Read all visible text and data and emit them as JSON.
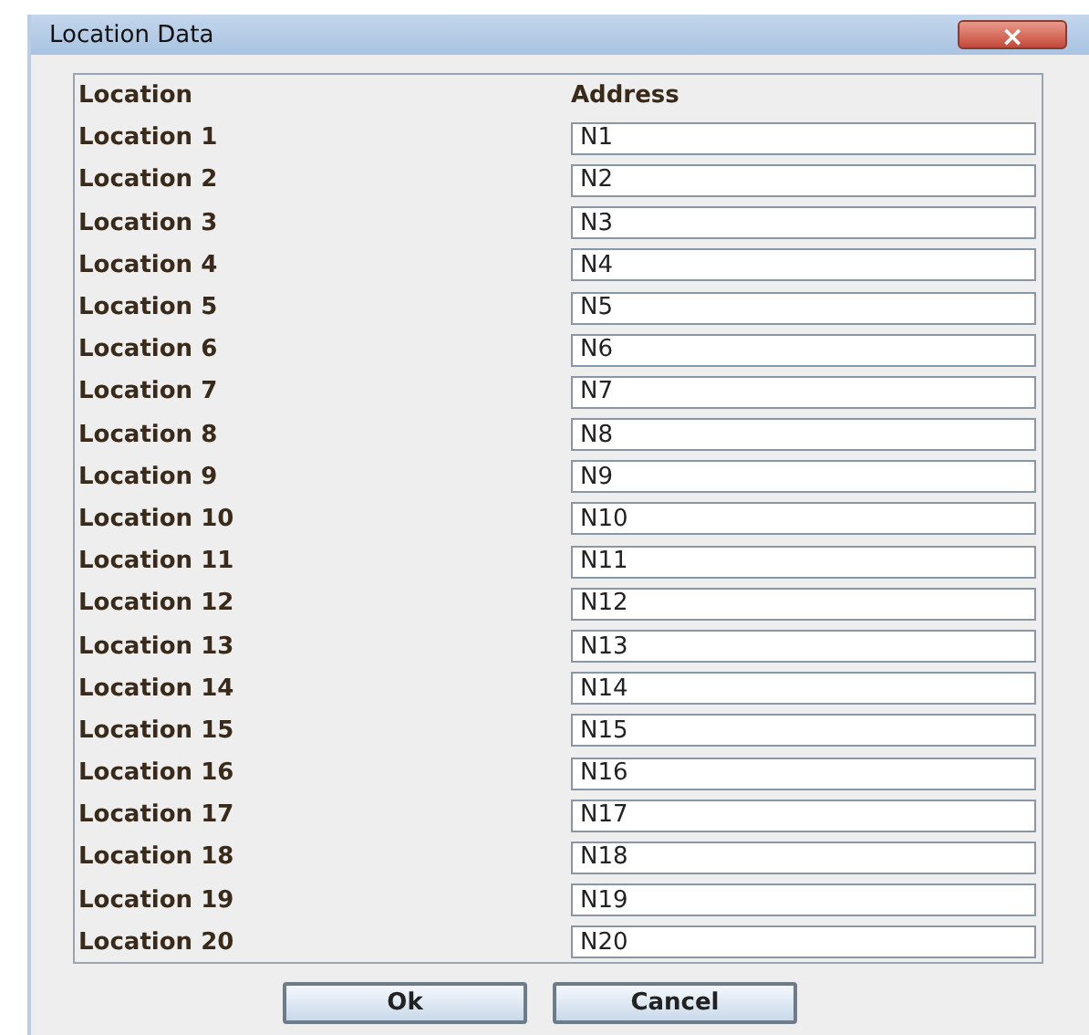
{
  "window": {
    "title": "Location Data",
    "close": "×"
  },
  "table": {
    "columns": [
      "Location",
      "Address"
    ],
    "rows": [
      {
        "label": "Location 1",
        "value": "N1"
      },
      {
        "label": "Location 2",
        "value": "N2"
      },
      {
        "label": "Location 3",
        "value": "N3"
      },
      {
        "label": "Location 4",
        "value": "N4"
      },
      {
        "label": "Location 5",
        "value": "N5"
      },
      {
        "label": "Location 6",
        "value": "N6"
      },
      {
        "label": "Location 7",
        "value": "N7"
      },
      {
        "label": "Location 8",
        "value": "N8"
      },
      {
        "label": "Location 9",
        "value": "N9"
      },
      {
        "label": "Location 10",
        "value": "N10"
      },
      {
        "label": "Location 11",
        "value": "N11"
      },
      {
        "label": "Location 12",
        "value": "N12"
      },
      {
        "label": "Location 13",
        "value": "N13"
      },
      {
        "label": "Location 14",
        "value": "N14"
      },
      {
        "label": "Location 15",
        "value": "N15"
      },
      {
        "label": "Location 16",
        "value": "N16"
      },
      {
        "label": "Location 17",
        "value": "N17"
      },
      {
        "label": "Location 18",
        "value": "N18"
      },
      {
        "label": "Location 19",
        "value": "N19"
      },
      {
        "label": "Location 20",
        "value": "N20"
      }
    ]
  },
  "buttons": [
    "Ok",
    "Cancel"
  ]
}
